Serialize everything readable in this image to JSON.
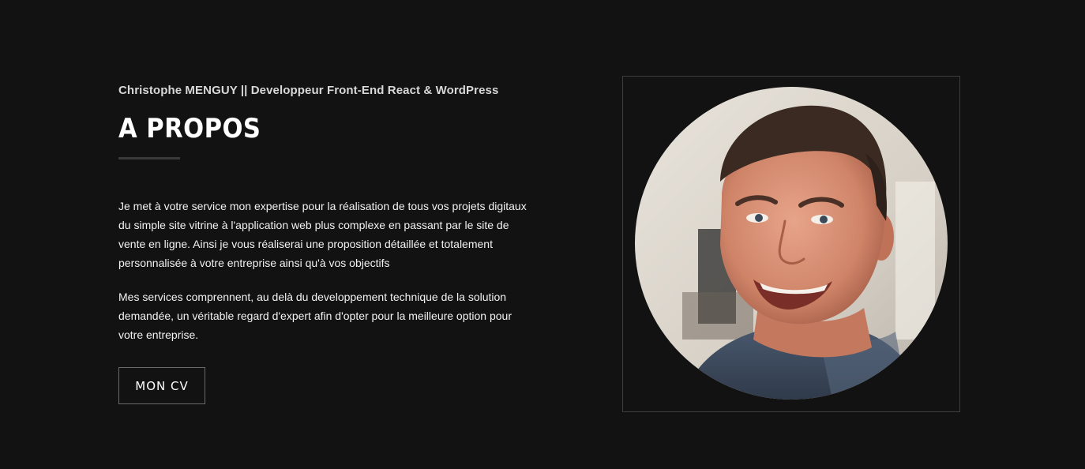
{
  "about": {
    "subtitle": "Christophe MENGUY || Developpeur Front-End React & WordPress",
    "heading": "A PROPOS",
    "paragraphs": [
      "Je met à votre service mon expertise pour la réalisation de tous vos projets digitaux du simple site vitrine à l'application web plus complexe en passant par le site de vente en ligne. Ainsi je vous réaliserai une proposition détaillée et totalement personnalisée à votre entreprise ainsi qu'à vos objectifs",
      "Mes services comprennent, au delà du developpement technique de la solution demandée, un véritable regard d'expert afin d'opter pour la meilleure option pour votre entreprise."
    ],
    "cv_button_label": "MON CV"
  },
  "colors": {
    "background": "#121212",
    "text": "#ffffff",
    "divider": "#3a3a3a",
    "frame_border": "#3d3d3d"
  }
}
